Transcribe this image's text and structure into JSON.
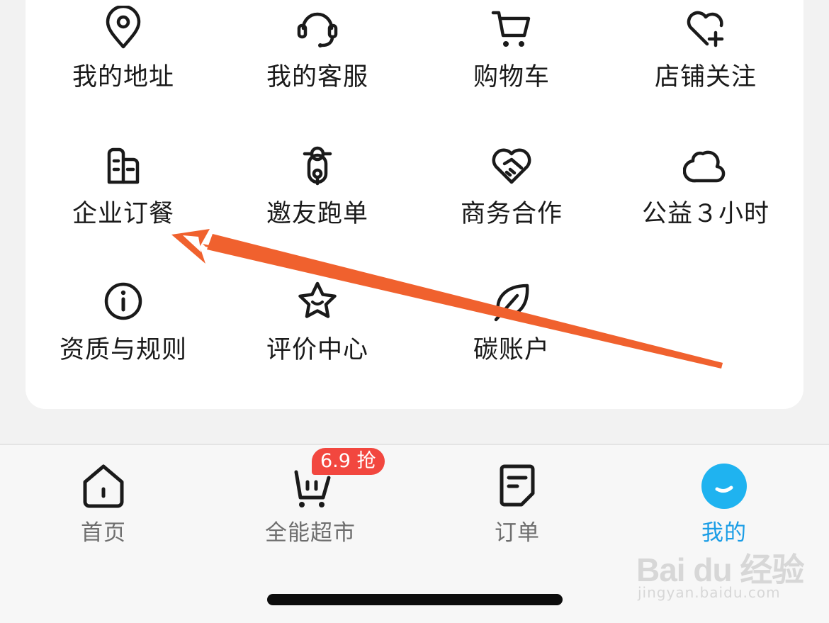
{
  "services": [
    {
      "label": "我的地址",
      "icon": "location-pin-icon"
    },
    {
      "label": "我的客服",
      "icon": "headset-icon"
    },
    {
      "label": "购物车",
      "icon": "shopping-cart-icon"
    },
    {
      "label": "店铺关注",
      "icon": "heart-plus-icon"
    },
    {
      "label": "企业订餐",
      "icon": "building-icon"
    },
    {
      "label": "邀友跑单",
      "icon": "rider-icon"
    },
    {
      "label": "商务合作",
      "icon": "handshake-heart-icon"
    },
    {
      "label": "公益３小时",
      "icon": "cloud-icon"
    },
    {
      "label": "资质与规则",
      "icon": "info-icon"
    },
    {
      "label": "评价中心",
      "icon": "star-smile-icon"
    },
    {
      "label": "碳账户",
      "icon": "leaf-icon"
    }
  ],
  "tabbar": {
    "tabs": [
      {
        "label": "首页",
        "icon": "home-icon",
        "active": false
      },
      {
        "label": "全能超市",
        "icon": "basket-icon",
        "active": false
      },
      {
        "label": "订单",
        "icon": "order-icon",
        "active": false
      },
      {
        "label": "我的",
        "icon": "profile-icon",
        "active": true
      }
    ],
    "promo_badge": "6.9 抢"
  },
  "annotation": {
    "type": "arrow",
    "color": "#f0612e",
    "points_to": "企业订餐"
  },
  "watermark": {
    "logo": "Bai du 经验",
    "url": "jingyan.baidu.com"
  },
  "colors": {
    "accent": "#1a9de6",
    "badge": "#f2473f",
    "arrow": "#f0612e",
    "icon": "#1a1a1a"
  }
}
